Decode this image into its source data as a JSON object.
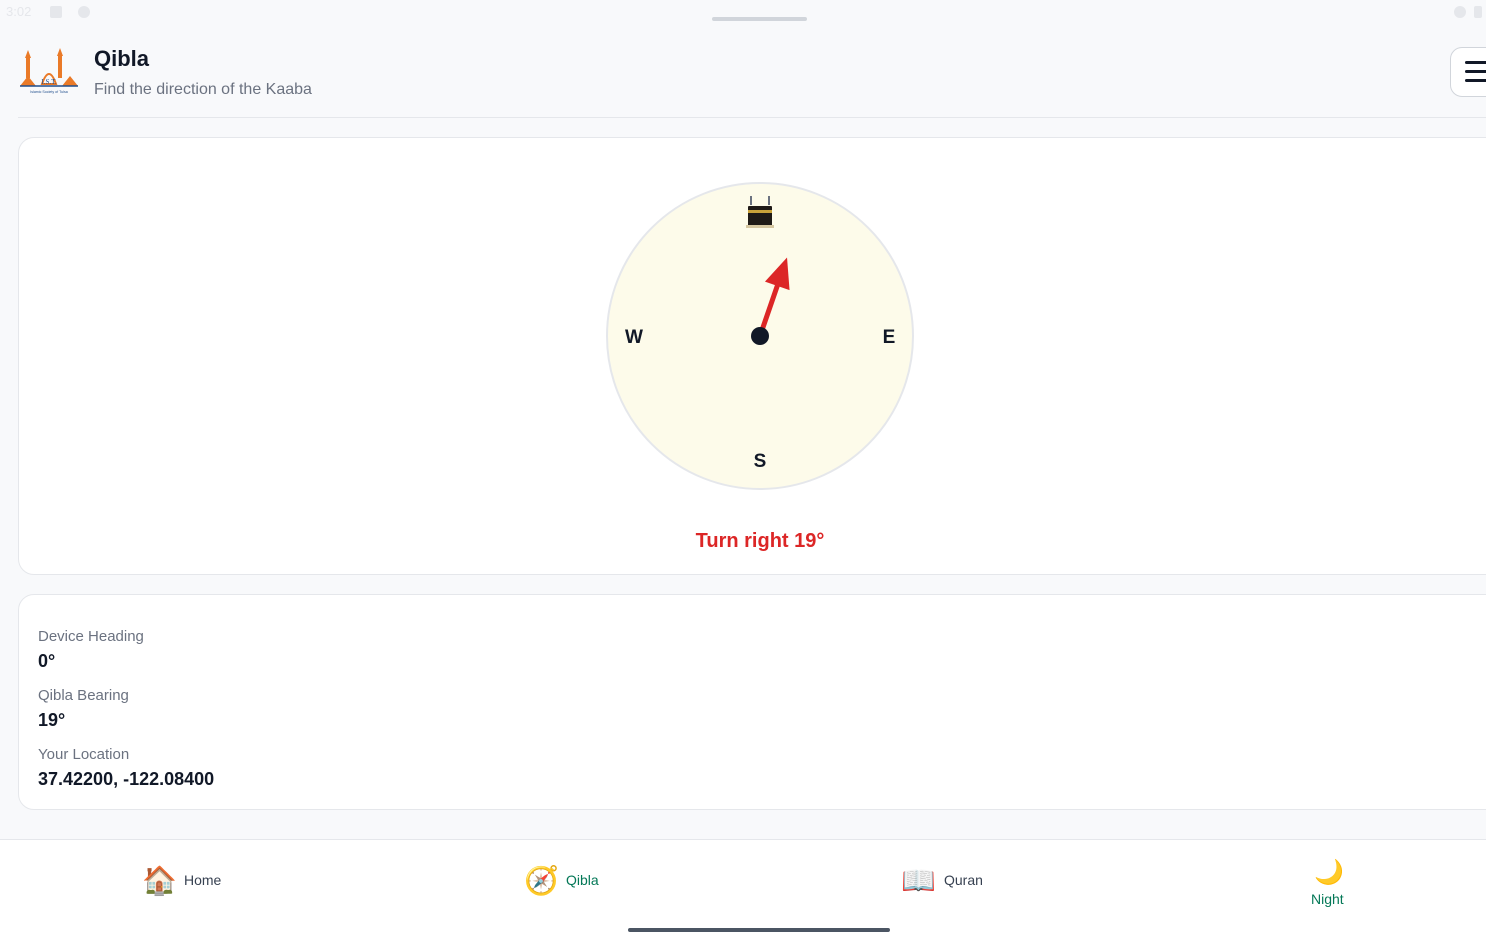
{
  "status_bar": {
    "time": "3:02"
  },
  "header": {
    "title": "Qibla",
    "subtitle": "Find the direction of the Kaaba",
    "logo_text": "I.S.T.",
    "logo_caption": "Islamic Society of Tulsa",
    "menu_icon": "hamburger-menu-icon"
  },
  "compass": {
    "directions": {
      "west": "W",
      "east": "E",
      "south": "S"
    },
    "kaaba_icon": "kaaba-icon",
    "needle_bearing_deg": 19,
    "turn_message": "Turn right 19°",
    "colors": {
      "dial": "#fdfbea",
      "needle": "#dc2626",
      "message": "#dc2626"
    }
  },
  "info": {
    "device_heading_label": "Device Heading",
    "device_heading_value": "0°",
    "qibla_bearing_label": "Qibla Bearing",
    "qibla_bearing_value": "19°",
    "location_label": "Your Location",
    "location_value": "37.42200, -122.08400"
  },
  "nav": {
    "items": [
      {
        "label": "Home",
        "icon": "house-icon",
        "glyph": "🏠",
        "active": false
      },
      {
        "label": "Qibla",
        "icon": "compass-icon",
        "glyph": "🧭",
        "active": true
      },
      {
        "label": "Quran",
        "icon": "open-book-icon",
        "glyph": "📖",
        "active": false
      },
      {
        "label": "Night",
        "icon": "crescent-moon-icon",
        "glyph": "🌙",
        "active": false
      }
    ],
    "active_color": "#047857"
  }
}
